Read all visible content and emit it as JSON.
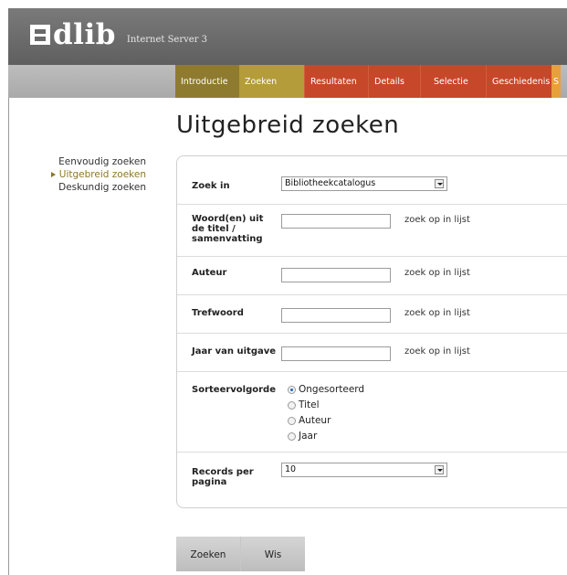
{
  "header": {
    "logo_text": "dlib",
    "subtitle": "Internet Server 3"
  },
  "nav": {
    "tabs": [
      {
        "label": "Introductie",
        "style": "olive"
      },
      {
        "label": "Zoeken",
        "style": "sel"
      },
      {
        "label": "Resultaten",
        "style": "red"
      },
      {
        "label": "Details",
        "style": "red"
      },
      {
        "label": "Selectie",
        "style": "red"
      },
      {
        "label": "Geschiedenis",
        "style": "red"
      },
      {
        "label": "S",
        "style": "orange"
      }
    ]
  },
  "sidebar": {
    "items": [
      {
        "label": "Eenvoudig zoeken",
        "active": false
      },
      {
        "label": "Uitgebreid zoeken",
        "active": true
      },
      {
        "label": "Deskundig zoeken",
        "active": false
      }
    ]
  },
  "page": {
    "title": "Uitgebreid zoeken"
  },
  "form": {
    "zoek_in": {
      "label": "Zoek in",
      "value": "Bibliotheekcatalogus"
    },
    "woord": {
      "label": "Woord(en) uit de titel / samenvatting",
      "value": "",
      "lookup": "zoek op in lijst"
    },
    "auteur": {
      "label": "Auteur",
      "value": "",
      "lookup": "zoek op in lijst"
    },
    "trefwoord": {
      "label": "Trefwoord",
      "value": "",
      "lookup": "zoek op in lijst"
    },
    "jaar": {
      "label": "Jaar van uitgave",
      "value": "",
      "lookup": "zoek op in lijst"
    },
    "sort": {
      "label": "Sorteervolgorde",
      "options": [
        "Ongesorteerd",
        "Titel",
        "Auteur",
        "Jaar"
      ],
      "selected": "Ongesorteerd"
    },
    "records": {
      "label": "Records per pagina",
      "value": "10"
    }
  },
  "buttons": {
    "search": "Zoeken",
    "clear": "Wis"
  }
}
